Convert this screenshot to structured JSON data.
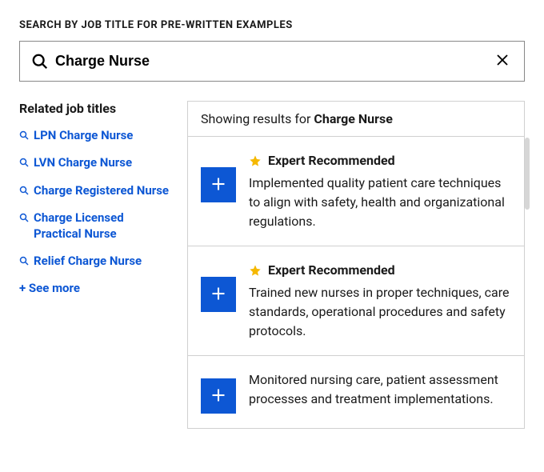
{
  "search": {
    "label": "SEARCH BY JOB TITLE FOR PRE-WRITTEN EXAMPLES",
    "value": "Charge Nurse"
  },
  "sidebar": {
    "heading": "Related job titles",
    "items": [
      {
        "label": "LPN Charge Nurse"
      },
      {
        "label": "LVN Charge Nurse"
      },
      {
        "label": "Charge Registered Nurse"
      },
      {
        "label": "Charge Licensed Practical Nurse"
      },
      {
        "label": "Relief Charge Nurse"
      }
    ],
    "see_more": "+ See more"
  },
  "results": {
    "showing_prefix": "Showing results for ",
    "query": "Charge Nurse",
    "recommended_label": "Expert Recommended",
    "items": [
      {
        "recommended": true,
        "text": "Implemented quality patient care techniques to align with safety, health and organizational regulations."
      },
      {
        "recommended": true,
        "text": "Trained new nurses in proper techniques, care standards, operational procedures and safety protocols."
      },
      {
        "recommended": false,
        "text": "Monitored nursing care, patient assessment processes and treatment implementations."
      }
    ]
  }
}
